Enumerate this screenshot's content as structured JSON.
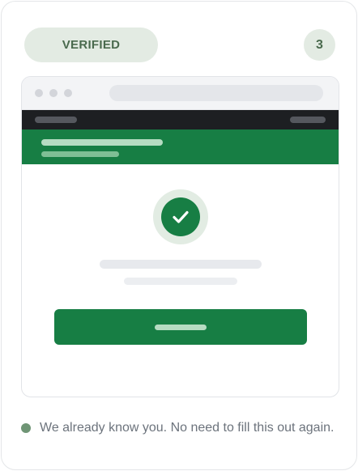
{
  "badge": {
    "label": "VERIFIED"
  },
  "step": {
    "number": "3"
  },
  "window": {
    "status_icon": "check-circle-icon"
  },
  "footer_note": {
    "text": "We already know you. No need to fill this out again."
  },
  "colors": {
    "accent_green": "#177e44",
    "badge_bg": "#e3ebe3",
    "badge_text": "#4a6a4e",
    "status_dot": "#6f9575"
  }
}
